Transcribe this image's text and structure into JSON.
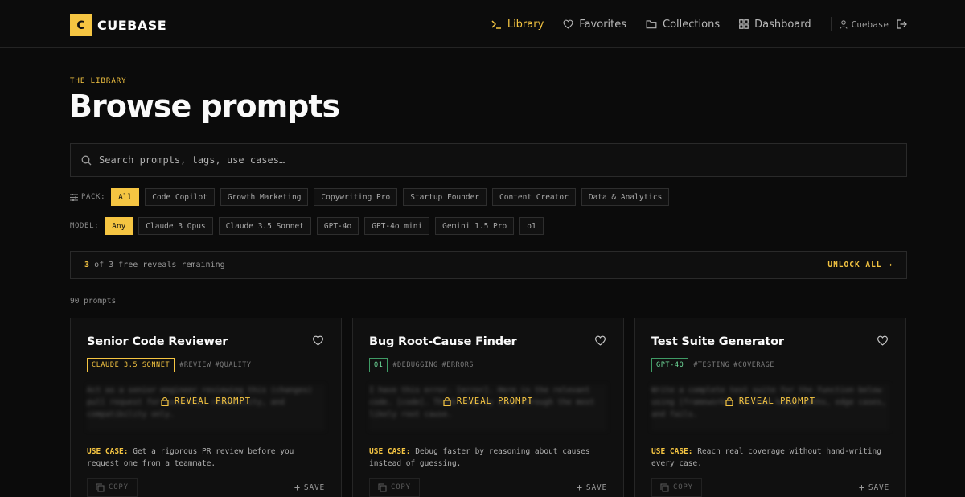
{
  "brand": {
    "mark": "C",
    "name": "CUEBASE"
  },
  "nav": {
    "items": [
      {
        "label": "Library",
        "active": true
      },
      {
        "label": "Favorites",
        "active": false
      },
      {
        "label": "Collections",
        "active": false
      },
      {
        "label": "Dashboard",
        "active": false
      }
    ],
    "user": "Cuebase"
  },
  "page": {
    "eyebrow": "THE LIBRARY",
    "title": "Browse prompts"
  },
  "search": {
    "placeholder": "Search prompts, tags, use cases…"
  },
  "filters": {
    "pack_label": "PACK:",
    "packs": [
      "All",
      "Code Copilot",
      "Growth Marketing",
      "Copywriting Pro",
      "Startup Founder",
      "Content Creator",
      "Data & Analytics"
    ],
    "model_label": "MODEL:",
    "models": [
      "Any",
      "Claude 3 Opus",
      "Claude 3.5 Sonnet",
      "GPT-4o",
      "GPT-4o mini",
      "Gemini 1.5 Pro",
      "o1"
    ]
  },
  "reveals": {
    "used": "3",
    "text": "of 3 free reveals remaining",
    "unlock": "UNLOCK ALL →"
  },
  "count": "90 prompts",
  "labels": {
    "reveal": "REVEAL PROMPT",
    "use_case": "USE CASE:",
    "copy": "COPY",
    "save": "SAVE"
  },
  "cards": [
    {
      "title": "Senior Code Reviewer",
      "model": "CLAUDE 3.5 SONNET",
      "tags": [
        "#REVIEW",
        "#QUALITY"
      ],
      "preview": "Act as a senior engineer reviewing this (changes) pull request for security, readability, and compatibility only.",
      "use_case": "Get a rigorous PR review before you request one from a teammate."
    },
    {
      "title": "Bug Root-Cause Finder",
      "model": "O1",
      "tags": [
        "#DEBUGGING",
        "#ERRORS"
      ],
      "preview": "I have this error. [error]. Here is the relevant code. [code]. Think step by step through the most likely root cause.",
      "use_case": "Debug faster by reasoning about causes instead of guessing."
    },
    {
      "title": "Test Suite Generator",
      "model": "GPT-4O",
      "tags": [
        "#TESTING",
        "#COVERAGE"
      ],
      "preview": "Write a complete test suite for the function below using [framework]. Include happy paths, edge cases, and fails.",
      "use_case": "Reach real coverage without hand-writing every case."
    }
  ],
  "colors": {
    "accent": "#f5c542",
    "background": "#0b0b0b",
    "green_tag": "#6fdc9b"
  }
}
